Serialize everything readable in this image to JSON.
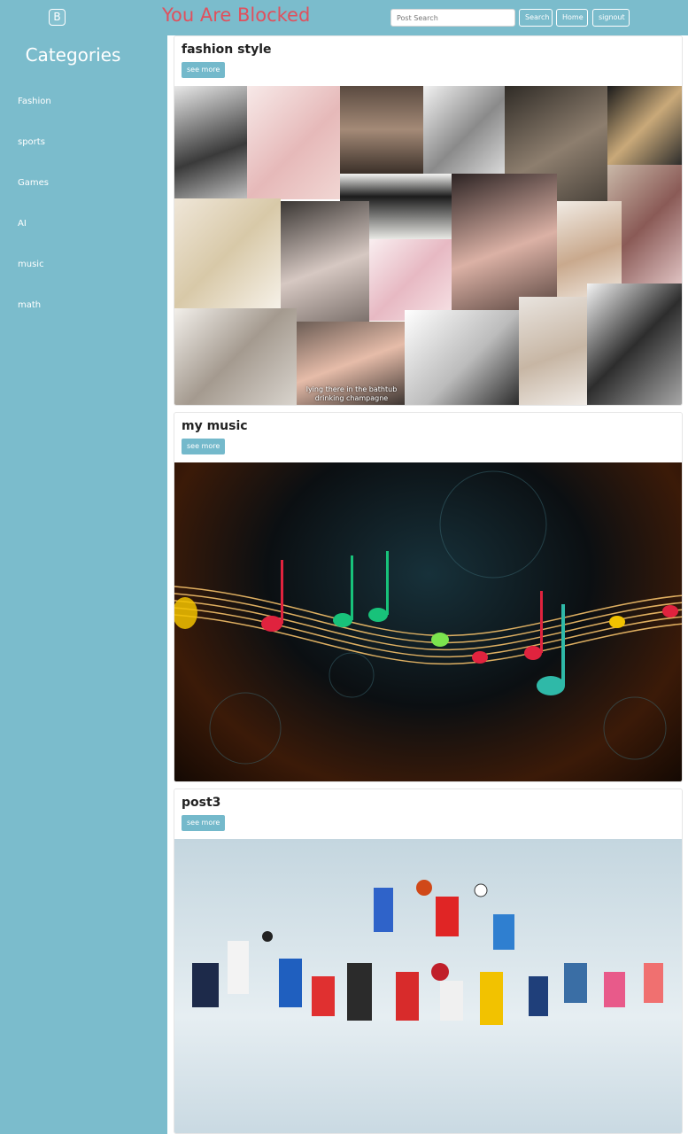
{
  "header": {
    "logo_text": "B",
    "site_title": "You Are Blocked",
    "search_placeholder": "Post Search",
    "search_button": "Search",
    "home_button": "Home",
    "signout_button": "signout"
  },
  "sidebar": {
    "title": "Categories",
    "items": [
      {
        "label": "Fashion"
      },
      {
        "label": "sports"
      },
      {
        "label": "Games"
      },
      {
        "label": "AI"
      },
      {
        "label": "music"
      },
      {
        "label": "math"
      }
    ]
  },
  "posts": [
    {
      "title": "fashion style",
      "button": "see more",
      "image_caption": "lying there in the bathtub drinking champagne",
      "image_theme": "fashion-collage"
    },
    {
      "title": "my music",
      "button": "see more",
      "image_theme": "music-notes"
    },
    {
      "title": "post3",
      "button": "see more",
      "image_theme": "sports-athletes"
    }
  ],
  "colors": {
    "background": "#7bbccc",
    "title_red": "#e0505d",
    "button": "#74b9cb"
  }
}
